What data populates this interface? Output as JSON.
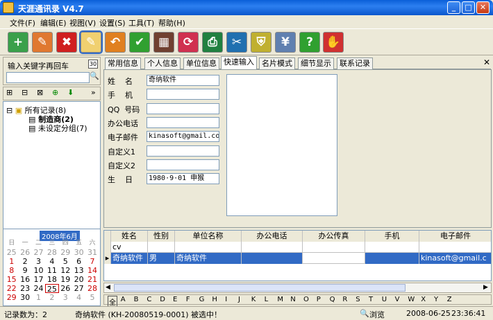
{
  "window": {
    "title": "天涯通讯录 V4.7"
  },
  "menu": [
    "文件(F)",
    "编辑(E)",
    "视图(V)",
    "设置(S)",
    "工具(T)",
    "帮助(H)"
  ],
  "toolbar": [
    {
      "icon": "add-contact-icon",
      "color": "#3aa04a",
      "glyph": "+"
    },
    {
      "icon": "edit-card-icon",
      "color": "#e07830",
      "glyph": "✎"
    },
    {
      "icon": "delete-icon",
      "color": "#d02020",
      "glyph": "✖"
    },
    {
      "icon": "notepad-icon",
      "color": "#f0d070",
      "glyph": "✎"
    },
    {
      "icon": "undo-icon",
      "color": "#e08020",
      "glyph": "↶"
    },
    {
      "icon": "checkmark-icon",
      "color": "#30a030",
      "glyph": "✔"
    },
    {
      "icon": "grid-view-icon",
      "color": "#704030",
      "glyph": "▦"
    },
    {
      "icon": "refresh-icon",
      "color": "#d03050",
      "glyph": "⟳"
    },
    {
      "icon": "print-icon",
      "color": "#208040",
      "glyph": "⎙"
    },
    {
      "icon": "tools-icon",
      "color": "#2070b0",
      "glyph": "✂"
    },
    {
      "icon": "shield-icon",
      "color": "#c0b030",
      "glyph": "⛨"
    },
    {
      "icon": "yen-icon",
      "color": "#6080b0",
      "glyph": "¥"
    },
    {
      "icon": "help-icon",
      "color": "#30a030",
      "glyph": "?"
    },
    {
      "icon": "exit-hand-icon",
      "color": "#d03030",
      "glyph": "✋"
    }
  ],
  "left": {
    "search_label": "输入关键字再回车",
    "search_badge": "30",
    "search_value": "",
    "tree": {
      "root": "所有记录(8)",
      "children": [
        "制造商(2)",
        "未设定分组(7)"
      ]
    }
  },
  "calendar": {
    "month": "2008年6月",
    "weekdays": [
      "日",
      "一",
      "二",
      "三",
      "四",
      "五",
      "六"
    ],
    "weeks": [
      [
        "25",
        "26",
        "27",
        "28",
        "29",
        "30",
        "31"
      ],
      [
        "1",
        "2",
        "3",
        "4",
        "5",
        "6",
        "7"
      ],
      [
        "8",
        "9",
        "10",
        "11",
        "12",
        "13",
        "14"
      ],
      [
        "15",
        "16",
        "17",
        "18",
        "19",
        "20",
        "21"
      ],
      [
        "22",
        "23",
        "24",
        "25",
        "26",
        "27",
        "28"
      ],
      [
        "29",
        "30",
        "1",
        "2",
        "3",
        "4",
        "5"
      ]
    ],
    "today": "25"
  },
  "tabs": [
    "常用信息",
    "个人信息",
    "单位信息",
    "快速输入",
    "名片模式",
    "细节显示",
    "联系记录"
  ],
  "active_tab": "快速输入",
  "form": [
    {
      "label": "姓    名",
      "value": "奇纳软件"
    },
    {
      "label": "手    机",
      "value": ""
    },
    {
      "label": "QQ  号码",
      "value": ""
    },
    {
      "label": "办公电话",
      "value": ""
    },
    {
      "label": "电子邮件",
      "value": "kinasoft@gmail.co"
    },
    {
      "label": "自定义1",
      "value": ""
    },
    {
      "label": "自定义2",
      "value": ""
    },
    {
      "label": "生    日",
      "value": "1980·9·01 申猴"
    }
  ],
  "grid": {
    "columns": [
      "姓名",
      "性别",
      "单位名称",
      "办公电话",
      "办公传真",
      "手机",
      "电子邮件"
    ],
    "rows": [
      [
        "cv",
        "",
        "",
        "",
        "",
        "",
        ""
      ],
      [
        "奇纳软件",
        "男",
        "奇纳软件",
        "",
        "",
        "",
        "kinasoft@gmail.c"
      ]
    ]
  },
  "alphabet": [
    "全",
    "A",
    "B",
    "C",
    "D",
    "E",
    "F",
    "G",
    "H",
    "I",
    "J",
    "K",
    "L",
    "M",
    "N",
    "O",
    "P",
    "Q",
    "R",
    "S",
    "T",
    "U",
    "V",
    "W",
    "X",
    "Y",
    "Z"
  ],
  "status": {
    "count": "记录数为：2",
    "message": "奇纳软件 (KH-20080519-0001) 被选中！",
    "mode": "浏览",
    "date": "2008-06-25",
    "time": "23:36:41"
  }
}
